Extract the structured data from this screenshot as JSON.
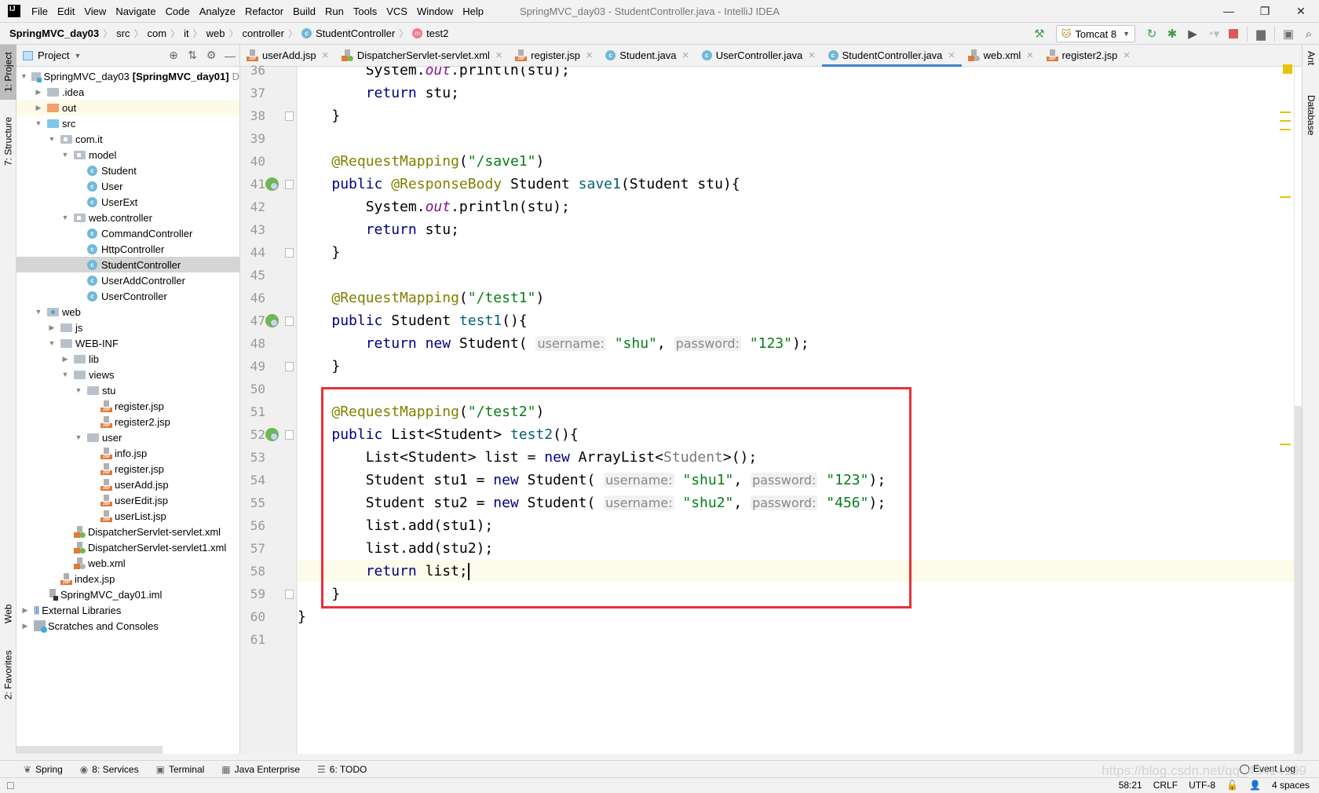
{
  "window": {
    "app_logo": "IJ",
    "title": "SpringMVC_day03 - StudentController.java - IntelliJ IDEA",
    "menu": [
      "File",
      "Edit",
      "View",
      "Navigate",
      "Code",
      "Analyze",
      "Refactor",
      "Build",
      "Run",
      "Tools",
      "VCS",
      "Window",
      "Help"
    ],
    "controls": {
      "minimize": "—",
      "restore": "❐",
      "close": "✕"
    }
  },
  "breadcrumb": {
    "items": [
      "SpringMVC_day03",
      "src",
      "com",
      "it",
      "web",
      "controller",
      "StudentController",
      "test2"
    ]
  },
  "toolbar": {
    "run_config": "Tomcat 8",
    "icons": [
      "build-hammer-icon",
      "update-restart-icon",
      "debug-icon",
      "run-with-coverage-icon",
      "profile-icon",
      "stop-icon",
      "project-structure-icon",
      "terminal-run-icon",
      "search-icon"
    ]
  },
  "left_stripe": {
    "project": "1: Project",
    "structure": "7: Structure",
    "web": "Web",
    "favorites": "2: Favorites"
  },
  "right_stripe": {
    "ant": "Ant",
    "database": "Database"
  },
  "project_panel": {
    "title": "Project",
    "tree": [
      {
        "label": "SpringMVC_day03",
        "suffix": "[SpringMVC_day01]",
        "trail": "D",
        "depth": 0,
        "arrow": "down",
        "icon": "module"
      },
      {
        "label": ".idea",
        "depth": 1,
        "arrow": "right",
        "icon": "folder"
      },
      {
        "label": "out",
        "depth": 1,
        "arrow": "right",
        "icon": "folder-orange",
        "highlight": true
      },
      {
        "label": "src",
        "depth": 1,
        "arrow": "down",
        "icon": "folder-blue"
      },
      {
        "label": "com.it",
        "depth": 2,
        "arrow": "down",
        "icon": "package"
      },
      {
        "label": "model",
        "depth": 3,
        "arrow": "down",
        "icon": "package"
      },
      {
        "label": "Student",
        "depth": 4,
        "icon": "class"
      },
      {
        "label": "User",
        "depth": 4,
        "icon": "class"
      },
      {
        "label": "UserExt",
        "depth": 4,
        "icon": "class"
      },
      {
        "label": "web.controller",
        "depth": 3,
        "arrow": "down",
        "icon": "package"
      },
      {
        "label": "CommandController",
        "depth": 4,
        "icon": "class"
      },
      {
        "label": "HttpController",
        "depth": 4,
        "icon": "class"
      },
      {
        "label": "StudentController",
        "depth": 4,
        "icon": "class",
        "selected": true
      },
      {
        "label": "UserAddController",
        "depth": 4,
        "icon": "class"
      },
      {
        "label": "UserController",
        "depth": 4,
        "icon": "class"
      },
      {
        "label": "web",
        "depth": 1,
        "arrow": "down",
        "icon": "folder-web"
      },
      {
        "label": "js",
        "depth": 2,
        "arrow": "right",
        "icon": "folder"
      },
      {
        "label": "WEB-INF",
        "depth": 2,
        "arrow": "down",
        "icon": "folder"
      },
      {
        "label": "lib",
        "depth": 3,
        "arrow": "right",
        "icon": "folder"
      },
      {
        "label": "views",
        "depth": 3,
        "arrow": "down",
        "icon": "folder"
      },
      {
        "label": "stu",
        "depth": 4,
        "arrow": "down",
        "icon": "folder"
      },
      {
        "label": "register.jsp",
        "depth": 5,
        "icon": "jsp"
      },
      {
        "label": "register2.jsp",
        "depth": 5,
        "icon": "jsp"
      },
      {
        "label": "user",
        "depth": 4,
        "arrow": "down",
        "icon": "folder"
      },
      {
        "label": "info.jsp",
        "depth": 5,
        "icon": "jsp"
      },
      {
        "label": "register.jsp",
        "depth": 5,
        "icon": "jsp"
      },
      {
        "label": "userAdd.jsp",
        "depth": 5,
        "icon": "jsp"
      },
      {
        "label": "userEdit.jsp",
        "depth": 5,
        "icon": "jsp"
      },
      {
        "label": "userList.jsp",
        "depth": 5,
        "icon": "jsp"
      },
      {
        "label": "DispatcherServlet-servlet.xml",
        "depth": 3,
        "icon": "xml-spring"
      },
      {
        "label": "DispatcherServlet-servlet1.xml",
        "depth": 3,
        "icon": "xml-spring"
      },
      {
        "label": "web.xml",
        "depth": 3,
        "icon": "xml-web"
      },
      {
        "label": "index.jsp",
        "depth": 2,
        "icon": "jsp"
      },
      {
        "label": "SpringMVC_day01.iml",
        "depth": 1,
        "icon": "iml"
      },
      {
        "label": "External Libraries",
        "depth": 0,
        "arrow": "right",
        "icon": "libs"
      },
      {
        "label": "Scratches and Consoles",
        "depth": 0,
        "arrow": "right",
        "icon": "scratch"
      }
    ]
  },
  "tabs": [
    {
      "label": "userAdd.jsp",
      "icon": "jsp"
    },
    {
      "label": "DispatcherServlet-servlet.xml",
      "icon": "xml-spring"
    },
    {
      "label": "register.jsp",
      "icon": "jsp"
    },
    {
      "label": "Student.java",
      "icon": "class"
    },
    {
      "label": "UserController.java",
      "icon": "class"
    },
    {
      "label": "StudentController.java",
      "icon": "class",
      "active": true
    },
    {
      "label": "web.xml",
      "icon": "xml-web"
    },
    {
      "label": "register2.jsp",
      "icon": "jsp"
    }
  ],
  "editor": {
    "first_line_partial": "36",
    "lines": [
      {
        "n": "36",
        "tokens": [
          [
            "",
            "        System."
          ],
          [
            "static",
            "out"
          ],
          [
            "",
            ".println(stu);"
          ]
        ],
        "partial": true
      },
      {
        "n": "37",
        "tokens": [
          [
            "",
            "        "
          ],
          [
            "kw",
            "return"
          ],
          [
            "",
            " stu;"
          ]
        ]
      },
      {
        "n": "38",
        "tokens": [
          [
            "",
            "    }"
          ]
        ],
        "fold": true
      },
      {
        "n": "39",
        "tokens": []
      },
      {
        "n": "40",
        "tokens": [
          [
            "",
            "    "
          ],
          [
            "ann",
            "@RequestMapping"
          ],
          [
            "",
            "("
          ],
          [
            "str",
            "\"/save1\""
          ],
          [
            "",
            ")"
          ]
        ]
      },
      {
        "n": "41",
        "tokens": [
          [
            "",
            "    "
          ],
          [
            "kw",
            "public"
          ],
          [
            "",
            " "
          ],
          [
            "ann",
            "@ResponseBody"
          ],
          [
            "",
            " Student "
          ],
          [
            "fn",
            "save1"
          ],
          [
            "",
            "(Student stu){"
          ]
        ],
        "gutter_icon": true,
        "fold": true
      },
      {
        "n": "42",
        "tokens": [
          [
            "",
            "        System."
          ],
          [
            "static",
            "out"
          ],
          [
            "",
            ".println(stu);"
          ]
        ]
      },
      {
        "n": "43",
        "tokens": [
          [
            "",
            "        "
          ],
          [
            "kw",
            "return"
          ],
          [
            "",
            " stu;"
          ]
        ]
      },
      {
        "n": "44",
        "tokens": [
          [
            "",
            "    }"
          ]
        ],
        "fold": true
      },
      {
        "n": "45",
        "tokens": []
      },
      {
        "n": "46",
        "tokens": [
          [
            "",
            "    "
          ],
          [
            "ann",
            "@RequestMapping"
          ],
          [
            "",
            "("
          ],
          [
            "str",
            "\"/test1\""
          ],
          [
            "",
            ")"
          ]
        ]
      },
      {
        "n": "47",
        "tokens": [
          [
            "",
            "    "
          ],
          [
            "kw",
            "public"
          ],
          [
            "",
            " Student "
          ],
          [
            "fn",
            "test1"
          ],
          [
            "",
            "(){"
          ]
        ],
        "gutter_icon": true,
        "fold": true
      },
      {
        "n": "48",
        "tokens": [
          [
            "",
            "        "
          ],
          [
            "kw",
            "return"
          ],
          [
            "",
            " "
          ],
          [
            "kw",
            "new"
          ],
          [
            "",
            " Student( "
          ],
          [
            "hint",
            "username:"
          ],
          [
            "",
            " "
          ],
          [
            "str",
            "\"shu\""
          ],
          [
            "",
            ", "
          ],
          [
            "hint",
            "password:"
          ],
          [
            "",
            " "
          ],
          [
            "str",
            "\"123\""
          ],
          [
            "",
            ");"
          ]
        ]
      },
      {
        "n": "49",
        "tokens": [
          [
            "",
            "    }"
          ]
        ],
        "fold": true
      },
      {
        "n": "50",
        "tokens": []
      },
      {
        "n": "51",
        "tokens": [
          [
            "",
            "    "
          ],
          [
            "ann",
            "@RequestMapping"
          ],
          [
            "",
            "("
          ],
          [
            "str",
            "\"/test2\""
          ],
          [
            "",
            ")"
          ]
        ]
      },
      {
        "n": "52",
        "tokens": [
          [
            "",
            "    "
          ],
          [
            "kw",
            "public"
          ],
          [
            "",
            " List<Student> "
          ],
          [
            "fn",
            "test2"
          ],
          [
            "",
            "(){"
          ]
        ],
        "gutter_icon": true,
        "fold": true
      },
      {
        "n": "53",
        "tokens": [
          [
            "",
            "        List<Student> list = "
          ],
          [
            "kw",
            "new"
          ],
          [
            "",
            " ArrayList<"
          ],
          [
            "type-param",
            "Student"
          ],
          [
            "",
            ">();"
          ]
        ]
      },
      {
        "n": "54",
        "tokens": [
          [
            "",
            "        Student stu1 = "
          ],
          [
            "kw",
            "new"
          ],
          [
            "",
            " Student( "
          ],
          [
            "hint",
            "username:"
          ],
          [
            "",
            " "
          ],
          [
            "str",
            "\"shu1\""
          ],
          [
            "",
            ", "
          ],
          [
            "hint",
            "password:"
          ],
          [
            "",
            " "
          ],
          [
            "str",
            "\"123\""
          ],
          [
            "",
            ");"
          ]
        ]
      },
      {
        "n": "55",
        "tokens": [
          [
            "",
            "        Student stu2 = "
          ],
          [
            "kw",
            "new"
          ],
          [
            "",
            " Student( "
          ],
          [
            "hint",
            "username:"
          ],
          [
            "",
            " "
          ],
          [
            "str",
            "\"shu2\""
          ],
          [
            "",
            ", "
          ],
          [
            "hint",
            "password:"
          ],
          [
            "",
            " "
          ],
          [
            "str",
            "\"456\""
          ],
          [
            "",
            ");"
          ]
        ]
      },
      {
        "n": "56",
        "tokens": [
          [
            "",
            "        list.add(stu1);"
          ]
        ]
      },
      {
        "n": "57",
        "tokens": [
          [
            "",
            "        list.add(stu2);"
          ]
        ]
      },
      {
        "n": "58",
        "tokens": [
          [
            "",
            "        "
          ],
          [
            "kw",
            "return"
          ],
          [
            "",
            " list;"
          ],
          [
            "caret",
            ""
          ]
        ],
        "current": true
      },
      {
        "n": "59",
        "tokens": [
          [
            "",
            "    }"
          ]
        ],
        "fold": true
      },
      {
        "n": "60",
        "tokens": [
          [
            "",
            "}"
          ]
        ]
      },
      {
        "n": "61",
        "tokens": []
      }
    ]
  },
  "bottom_tools": [
    {
      "label": "Spring",
      "icon": "spring-leaf-icon"
    },
    {
      "label": "8: Services",
      "icon": "services-icon"
    },
    {
      "label": "Terminal",
      "icon": "terminal-icon"
    },
    {
      "label": "Java Enterprise",
      "icon": "java-enterprise-icon"
    },
    {
      "label": "6: TODO",
      "icon": "todo-list-icon"
    }
  ],
  "event_log": "Event Log",
  "status": {
    "position": "58:21",
    "line_separator": "CRLF",
    "encoding": "UTF-8",
    "indent": "4 spaces"
  },
  "watermark": "https://blog.csdn.net/qq_43414199"
}
